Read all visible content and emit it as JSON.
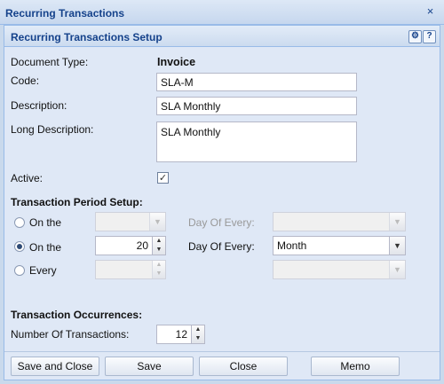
{
  "window": {
    "title": "Recurring Transactions",
    "close_icon": "×"
  },
  "panel": {
    "title": "Recurring Transactions Setup",
    "gear_icon": "⚙",
    "help_icon": "?"
  },
  "form": {
    "document_type_label": "Document Type:",
    "document_type_value": "Invoice",
    "code_label": "Code:",
    "code_value": "SLA-M",
    "description_label": "Description:",
    "description_value": "SLA Monthly",
    "long_description_label": "Long Description:",
    "long_description_value": "SLA Monthly",
    "active_label": "Active:",
    "active_checked": true
  },
  "period": {
    "section_label": "Transaction Period Setup:",
    "row1": {
      "radio_label": "On the",
      "selected": false,
      "value": "",
      "day_label": "Day Of Every:",
      "day_value": ""
    },
    "row2": {
      "radio_label": "On the",
      "selected": true,
      "value": "20",
      "day_label": "Day Of Every:",
      "day_value": "Month"
    },
    "row3": {
      "radio_label": "Every",
      "selected": false,
      "value": "",
      "unit_value": ""
    }
  },
  "occurrences": {
    "section_label": "Transaction Occurrences:",
    "number_label": "Number Of Transactions:",
    "number_value": "12"
  },
  "buttons": {
    "save_close": "Save and Close",
    "save": "Save",
    "close": "Close",
    "memo": "Memo"
  },
  "colors": {
    "title_text": "#15428b",
    "panel_bg": "#dfe8f6",
    "border": "#99bbe8"
  }
}
